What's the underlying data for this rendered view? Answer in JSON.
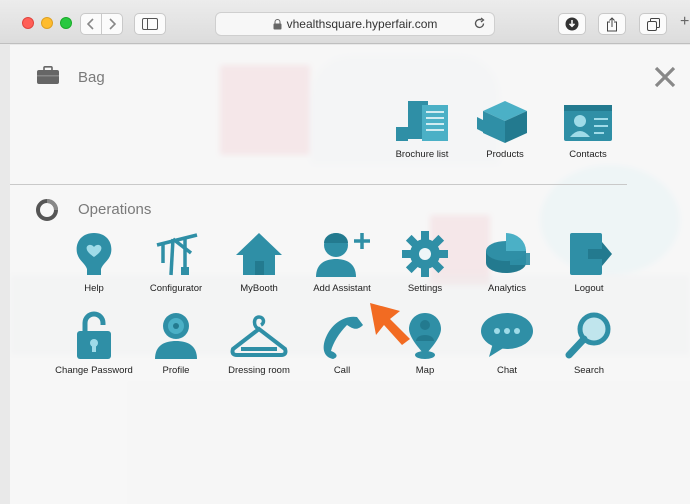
{
  "browser": {
    "url": "vhealthsquare.hyperfair.com"
  },
  "bag": {
    "title": "Bag",
    "items": [
      {
        "label": "Brochure list",
        "icon": "brochure-icon"
      },
      {
        "label": "Products",
        "icon": "products-cube-icon"
      },
      {
        "label": "Contacts",
        "icon": "contact-card-icon"
      }
    ]
  },
  "operations": {
    "title": "Operations",
    "row1": [
      {
        "label": "Help",
        "icon": "help-head-icon"
      },
      {
        "label": "Configurator",
        "icon": "crane-icon"
      },
      {
        "label": "MyBooth",
        "icon": "house-icon"
      },
      {
        "label": "Add Assistant",
        "icon": "add-assistant-icon"
      },
      {
        "label": "Settings",
        "icon": "gear-icon"
      },
      {
        "label": "Analytics",
        "icon": "pie-chart-icon"
      },
      {
        "label": "Logout",
        "icon": "logout-icon"
      }
    ],
    "row2": [
      {
        "label": "Change Password",
        "icon": "padlock-icon"
      },
      {
        "label": "Profile",
        "icon": "profile-icon"
      },
      {
        "label": "Dressing room",
        "icon": "hanger-icon"
      },
      {
        "label": "Call",
        "icon": "phone-icon"
      },
      {
        "label": "Map",
        "icon": "map-pin-person-icon"
      },
      {
        "label": "Chat",
        "icon": "chat-bubble-icon"
      },
      {
        "label": "Search",
        "icon": "magnifier-icon"
      }
    ]
  },
  "colors": {
    "icon_teal": "#2f8fa6",
    "icon_teal_light": "#4bb0c6",
    "cursor_orange": "#f26b22"
  }
}
